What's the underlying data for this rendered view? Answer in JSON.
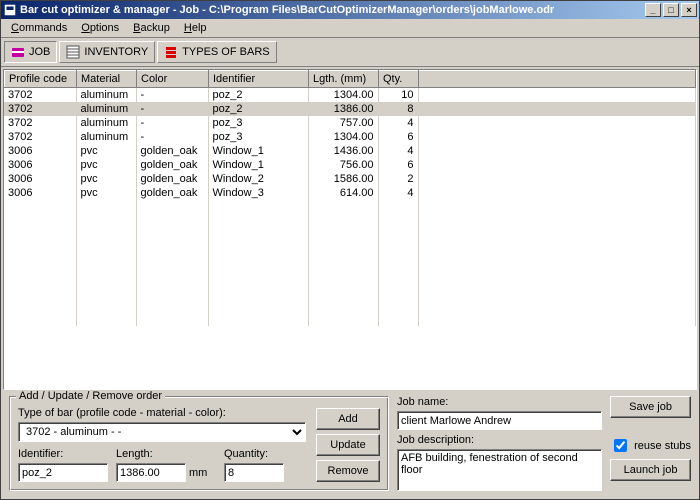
{
  "window": {
    "title": "Bar cut optimizer & manager - Job - C:\\Program Files\\BarCutOptimizerManager\\orders\\jobMarlowe.odr"
  },
  "menubar": {
    "items": [
      {
        "label": "Commands",
        "u": 0
      },
      {
        "label": "Options",
        "u": 0
      },
      {
        "label": "Backup",
        "u": 0
      },
      {
        "label": "Help",
        "u": 0
      }
    ]
  },
  "toolbar": {
    "job": "JOB",
    "inventory": "INVENTORY",
    "types": "TYPES OF BARS"
  },
  "grid": {
    "headers": [
      "Profile code",
      "Material",
      "Color",
      "Identifier",
      "Lgth. (mm)",
      "Qty."
    ],
    "rows": [
      {
        "code": "3702",
        "material": "aluminum",
        "color": "-",
        "ident": "poz_2",
        "len": "1304.00",
        "qty": "10"
      },
      {
        "code": "3702",
        "material": "aluminum",
        "color": "-",
        "ident": "poz_2",
        "len": "1386.00",
        "qty": "8",
        "sel": true
      },
      {
        "code": "3702",
        "material": "aluminum",
        "color": "-",
        "ident": "poz_3",
        "len": "757.00",
        "qty": "4"
      },
      {
        "code": "3702",
        "material": "aluminum",
        "color": "-",
        "ident": "poz_3",
        "len": "1304.00",
        "qty": "6"
      },
      {
        "code": "3006",
        "material": "pvc",
        "color": "golden_oak",
        "ident": "Window_1",
        "len": "1436.00",
        "qty": "4"
      },
      {
        "code": "3006",
        "material": "pvc",
        "color": "golden_oak",
        "ident": "Window_1",
        "len": "756.00",
        "qty": "6"
      },
      {
        "code": "3006",
        "material": "pvc",
        "color": "golden_oak",
        "ident": "Window_2",
        "len": "1586.00",
        "qty": "2"
      },
      {
        "code": "3006",
        "material": "pvc",
        "color": "golden_oak",
        "ident": "Window_3",
        "len": "614.00",
        "qty": "4"
      }
    ]
  },
  "form": {
    "group_title": "Add / Update / Remove order",
    "type_label": "Type of bar (profile code - material -  color):",
    "type_value": "3702 - aluminum - -",
    "ident_label": "Identifier:",
    "ident_value": "poz_2",
    "length_label": "Length:",
    "length_value": "1386.00",
    "length_unit": "mm",
    "qty_label": "Quantity:",
    "qty_value": "8",
    "add": "Add",
    "update": "Update",
    "remove": "Remove"
  },
  "job": {
    "name_label": "Job name:",
    "name_value": "client Marlowe Andrew",
    "desc_label": "Job description:",
    "desc_value": "AFB building, fenestration of second floor",
    "save": "Save job",
    "reuse": "reuse stubs",
    "launch": "Launch job"
  }
}
